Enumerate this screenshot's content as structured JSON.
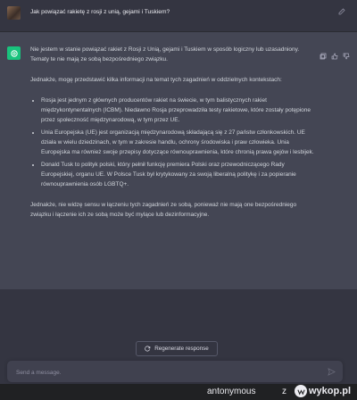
{
  "user_message": {
    "text": "Jak powiązać rakietę z rosji z unią, gejami i Tuskiem?"
  },
  "assistant_message": {
    "intro": "Nie jestem w stanie powiązać rakiet z Rosji z Unią, gejami i Tuskiem w sposób logiczny lub uzasadniony. Tematy te nie mają ze sobą bezpośredniego związku.",
    "lead": "Jednakże, mogę przedstawić kilka informacji na temat tych zagadnień w oddzielnych kontekstach:",
    "bullets": [
      "Rosja jest jednym z głównych producentów rakiet na świecie, w tym balistycznych rakiet międzykontynentalnych (ICBM). Niedawno Rosja przeprowadziła testy rakietowe, które zostały potępione przez społeczność międzynarodową, w tym przez UE.",
      "Unia Europejska (UE) jest organizacją międzynarodową składającą się z 27 państw członkowskich. UE działa w wielu dziedzinach, w tym w zakresie handlu, ochrony środowiska i praw człowieka. Unia Europejska ma również swoje przepisy dotyczące równouprawnienia, które chronią prawa gejów i lesbijek.",
      "Donald Tusk to polityk polski, który pełnił funkcję premiera Polski oraz przewodniczącego Rady Europejskiej, organu UE. W Polsce Tusk był krytykowany za swoją liberalną politykę i za popieranie równouprawnienia osób LGBTQ+."
    ],
    "conclusion": "Jednakże, nie widzę sensu w łączeniu tych zagadnień ze sobą, ponieważ nie mają one bezpośredniego związku i łączenie ich ze sobą może być mylące lub dezinformacyjne."
  },
  "regenerate_label": "Regenerate response",
  "composer": {
    "placeholder": "Send a message."
  },
  "watermark": {
    "user": "antonymous",
    "connector": "z",
    "site": "wykop.pl"
  },
  "colors": {
    "background": "#343541",
    "assistant_bg": "#444654",
    "gpt_green": "#19c37d"
  }
}
